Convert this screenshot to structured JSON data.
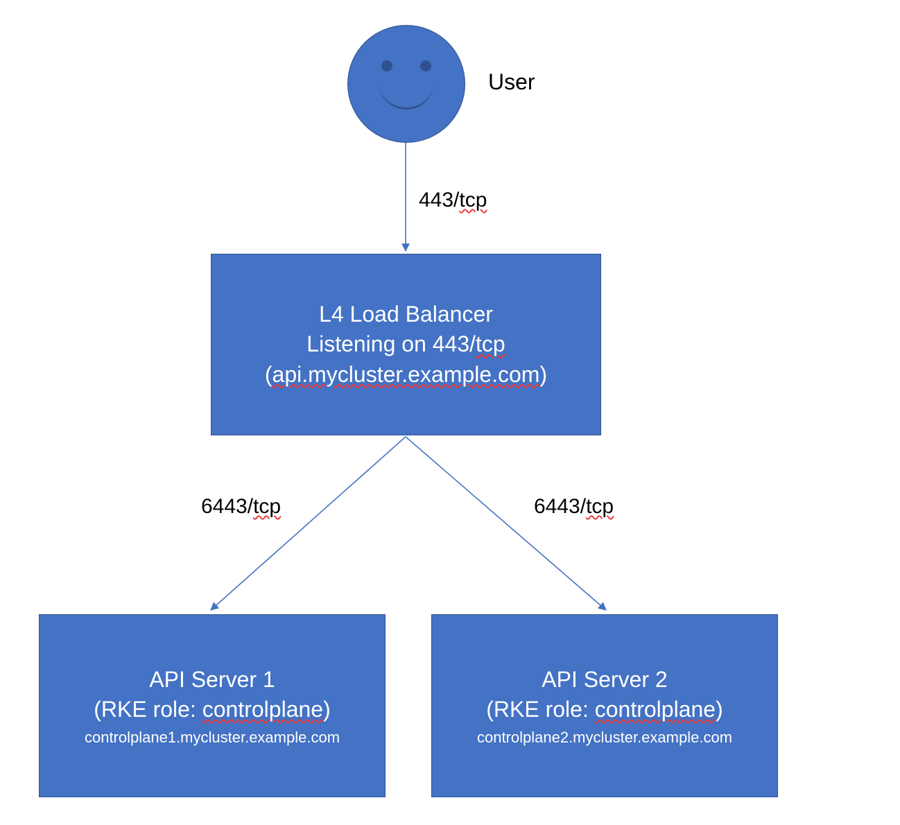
{
  "colors": {
    "node_fill": "#4472C4",
    "node_border": "#2F528F",
    "text_dark": "#000000",
    "text_light": "#FFFFFF"
  },
  "user": {
    "label": "User"
  },
  "edges": {
    "user_to_lb": {
      "text": "443/",
      "underlined": "tcp"
    },
    "lb_to_api1": {
      "text": "6443/",
      "underlined": "tcp"
    },
    "lb_to_api2": {
      "text": "6443/",
      "underlined": "tcp"
    }
  },
  "lb": {
    "line1": "L4 Load Balancer",
    "line2_a": "Listening on 443/",
    "line2_b": "tcp",
    "line3_a": "(",
    "line3_b": "api.mycluster.example.com",
    "line3_c": ")"
  },
  "api1": {
    "title": "API Server 1",
    "role_a": "(RKE role: ",
    "role_b": "controlplane",
    "role_c": ")",
    "host": "controlplane1.mycluster.example.com"
  },
  "api2": {
    "title": "API Server 2",
    "role_a": "(RKE role: ",
    "role_b": "controlplane",
    "role_c": ")",
    "host": "controlplane2.mycluster.example.com"
  }
}
